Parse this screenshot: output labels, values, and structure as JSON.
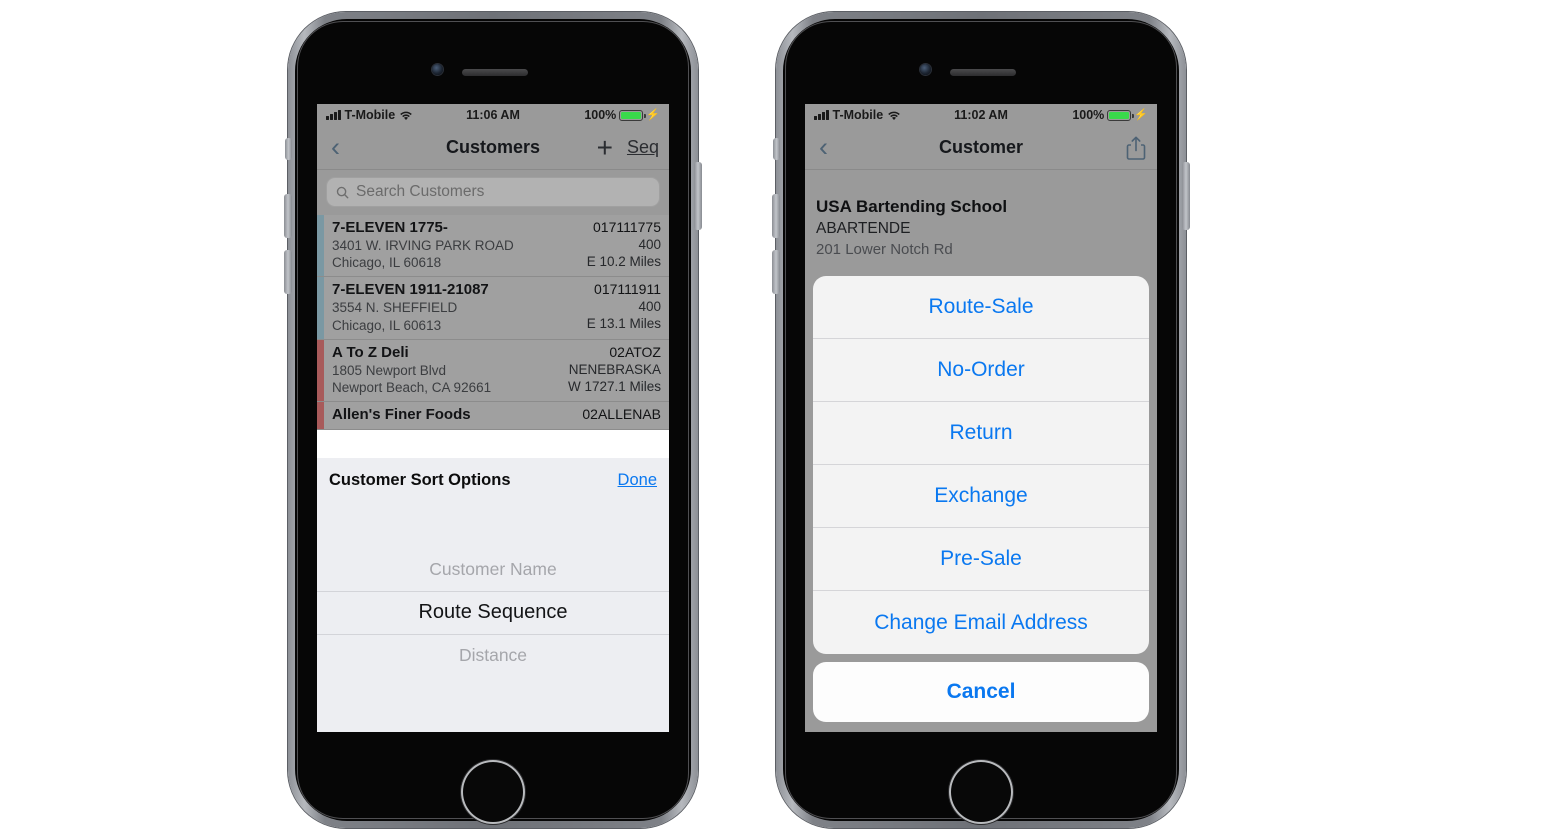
{
  "left_phone": {
    "status_bar": {
      "carrier": "T-Mobile",
      "time": "11:06 AM",
      "battery_pct": "100%"
    },
    "nav": {
      "back": "‹",
      "title": "Customers",
      "add": "+",
      "seq": "Seq"
    },
    "search": {
      "placeholder": "Search Customers"
    },
    "customers": [
      {
        "name": "7-ELEVEN 1775-",
        "address": "3401 W. IRVING PARK ROAD",
        "city": "Chicago, IL  60618",
        "id": "017111775",
        "number": "400",
        "distance": "E 10.2 Miles",
        "bar_color": "#7a98a3"
      },
      {
        "name": "7-ELEVEN 1911-21087",
        "address": "3554 N. SHEFFIELD",
        "city": "Chicago, IL  60613",
        "id": "017111911",
        "number": "400",
        "distance": "E 13.1 Miles",
        "bar_color": "#7a98a3"
      },
      {
        "name": "A To Z Deli",
        "address": "1805 Newport Blvd",
        "city": "Newport Beach, CA  92661",
        "id": "02ATOZ",
        "number": "NENEBRASKA",
        "distance": "W 1727.1 Miles",
        "bar_color": "#a85a5a"
      },
      {
        "name": "Allen's Finer Foods",
        "address": "",
        "city": "",
        "id": "02ALLENAB",
        "number": "",
        "distance": "",
        "bar_color": "#a85a5a"
      }
    ],
    "sort_sheet": {
      "title": "Customer Sort Options",
      "done_label": "Done",
      "options": [
        "Customer Name",
        "Route Sequence",
        "Distance"
      ],
      "selected": "Route Sequence"
    }
  },
  "right_phone": {
    "status_bar": {
      "carrier": "T-Mobile",
      "time": "11:02 AM",
      "battery_pct": "100%"
    },
    "nav": {
      "back": "‹",
      "title": "Customer",
      "share_icon": "share-icon"
    },
    "detail": {
      "name": "USA Bartending School",
      "code": "ABARTENDE",
      "address": "201 Lower Notch Rd"
    },
    "action_sheet": {
      "items": [
        "Route-Sale",
        "No-Order",
        "Return",
        "Exchange",
        "Pre-Sale",
        "Change Email Address"
      ],
      "cancel_label": "Cancel"
    }
  },
  "theme": {
    "accent_blue": "#0a78f0",
    "nav_back_blue": "#4d6274",
    "battery_green": "#39d94b",
    "dim_overlay": "#9a9a9a"
  }
}
